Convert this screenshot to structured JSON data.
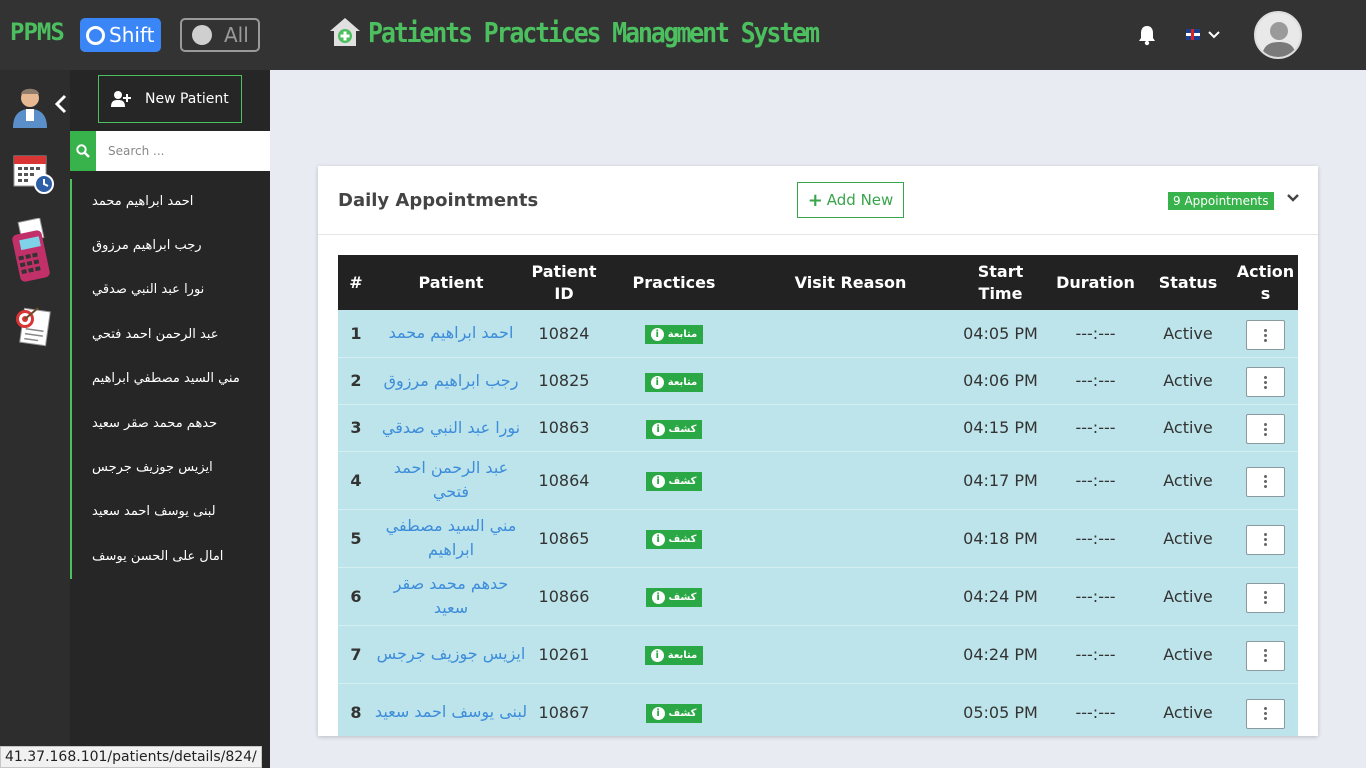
{
  "topbar": {
    "brand": "PPMS",
    "shift_label": "Shift",
    "all_label": "All",
    "app_title": "Patients Practices Managment System",
    "language": "English"
  },
  "sidebar": {
    "new_patient_label": "New Patient",
    "search_placeholder": "Search ...",
    "patients": [
      "احمد ابراهيم محمد",
      "رجب ابراهيم مرزوق",
      "نورا عبد النبي صدقي",
      "عبد الرحمن احمد فتحي",
      "مني السيد مصطفي ابراهيم",
      "حدهم محمد صقر سعيد",
      "ايزيس جوزيف جرجس",
      "لبنى يوسف احمد سعيد",
      "امال على الحسن يوسف"
    ]
  },
  "card": {
    "title": "Daily Appointments",
    "add_new_label": "Add New",
    "count_badge": "9 Appointments"
  },
  "table": {
    "headers": {
      "num": "#",
      "patient": "Patient",
      "patient_id_1": "Patient",
      "patient_id_2": "ID",
      "practices": "Practices",
      "visit_reason": "Visit Reason",
      "start_time_1": "Start",
      "start_time_2": "Time",
      "duration": "Duration",
      "status": "Status",
      "actions_1": "Action",
      "actions_2": "s"
    },
    "rows": [
      {
        "num": "1",
        "patient": "احمد ابراهيم محمد",
        "id": "10824",
        "practice": "متابعة",
        "reason": "",
        "time": "04:05 PM",
        "duration": "---:---",
        "status": "Active"
      },
      {
        "num": "2",
        "patient": "رجب ابراهيم مرزوق",
        "id": "10825",
        "practice": "متابعة",
        "reason": "",
        "time": "04:06 PM",
        "duration": "---:---",
        "status": "Active"
      },
      {
        "num": "3",
        "patient": "نورا عبد النبي صدقي",
        "id": "10863",
        "practice": "كشف",
        "reason": "",
        "time": "04:15 PM",
        "duration": "---:---",
        "status": "Active"
      },
      {
        "num": "4",
        "patient": "عبد الرحمن احمد فتحي",
        "id": "10864",
        "practice": "كشف",
        "reason": "",
        "time": "04:17 PM",
        "duration": "---:---",
        "status": "Active"
      },
      {
        "num": "5",
        "patient": "مني السيد مصطفي ابراهيم",
        "id": "10865",
        "practice": "كشف",
        "reason": "",
        "time": "04:18 PM",
        "duration": "---:---",
        "status": "Active"
      },
      {
        "num": "6",
        "patient": "حدهم محمد صقر سعيد",
        "id": "10866",
        "practice": "كشف",
        "reason": "",
        "time": "04:24 PM",
        "duration": "---:---",
        "status": "Active"
      },
      {
        "num": "7",
        "patient": "ايزيس جوزيف جرجس",
        "id": "10261",
        "practice": "متابعة",
        "reason": "",
        "time": "04:24 PM",
        "duration": "---:---",
        "status": "Active"
      },
      {
        "num": "8",
        "patient": "لبنى يوسف احمد سعيد",
        "id": "10867",
        "practice": "كشف",
        "reason": "",
        "time": "05:05 PM",
        "duration": "---:---",
        "status": "Active"
      }
    ]
  },
  "status_url": "41.37.168.101/patients/details/824/",
  "colors": {
    "brand_green": "#4cbf5f",
    "topbar_bg": "#333333",
    "shift_blue": "#3b86f7",
    "row_bg": "#bde4ea",
    "link_blue": "#3d8ddb"
  }
}
